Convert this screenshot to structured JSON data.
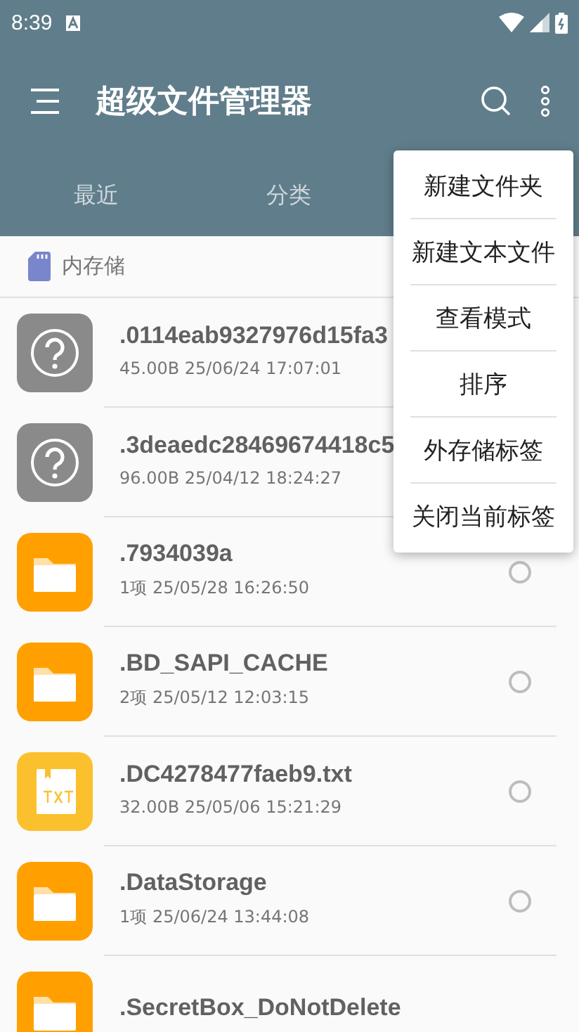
{
  "status_bar": {
    "time": "8:39"
  },
  "app_bar": {
    "title": "超级文件管理器"
  },
  "tabs": [
    {
      "label": "最近",
      "selected": false
    },
    {
      "label": "分类",
      "selected": false
    }
  ],
  "breadcrumb": {
    "label": "内存储"
  },
  "files": [
    {
      "kind": "unknown",
      "name": ".0114eab9327976d15fa3",
      "meta": "45.00B  25/06/24 17:07:01"
    },
    {
      "kind": "unknown",
      "name": ".3deaedc28469674418c5",
      "meta": "96.00B  25/04/12 18:24:27"
    },
    {
      "kind": "folder",
      "name": ".7934039a",
      "meta": "1项  25/05/28 16:26:50",
      "selected": false
    },
    {
      "kind": "folder",
      "name": ".BD_SAPI_CACHE",
      "meta": "2项  25/05/12 12:03:15",
      "selected": false
    },
    {
      "kind": "txt",
      "name": ".DC4278477faeb9.txt",
      "meta": "32.00B  25/05/06 15:21:29",
      "selected": false
    },
    {
      "kind": "folder",
      "name": ".DataStorage",
      "meta": "1项  25/06/24 13:44:08",
      "selected": false
    },
    {
      "kind": "folder",
      "name": ".SecretBox_DoNotDelete"
    }
  ],
  "menu": {
    "items": [
      "新建文件夹",
      "新建文本文件",
      "查看模式",
      "排序",
      "外存储标签",
      "关闭当前标签"
    ]
  }
}
